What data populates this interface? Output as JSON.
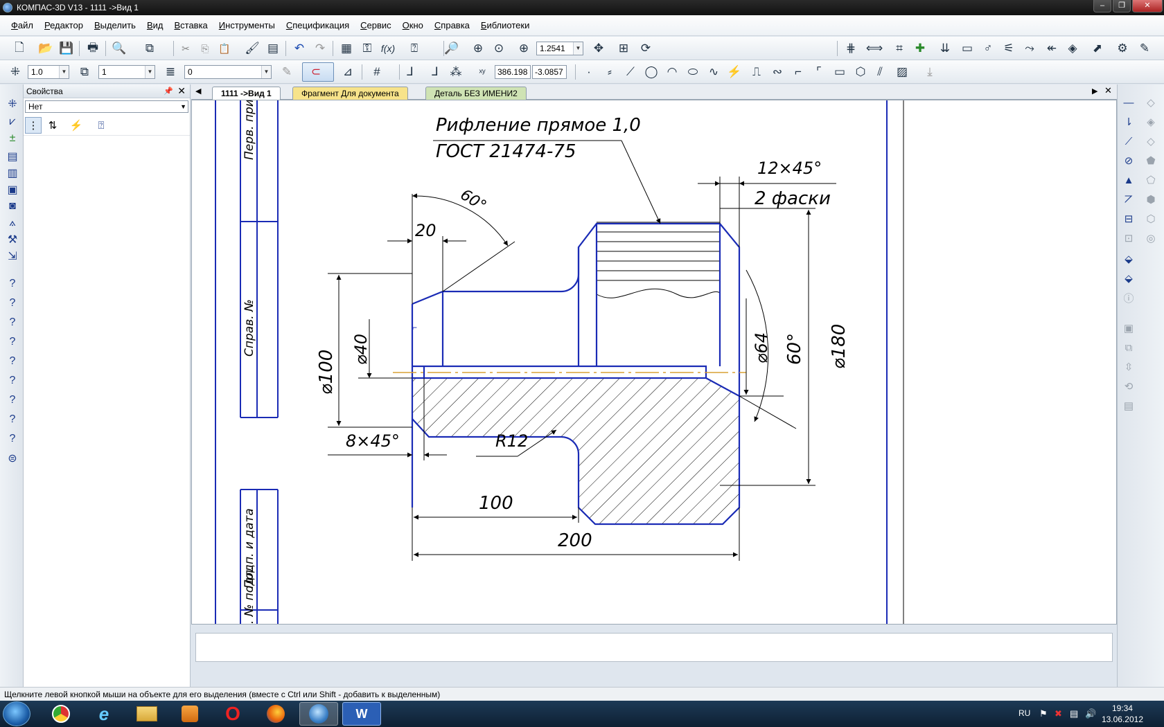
{
  "window": {
    "title": "КОМПАС-3D V13 - 1111 ->Вид 1",
    "controls": [
      "‒",
      "❐",
      "✕"
    ]
  },
  "menu": [
    "Файл",
    "Редактор",
    "Выделить",
    "Вид",
    "Вставка",
    "Инструменты",
    "Спецификация",
    "Сервис",
    "Окно",
    "Справка",
    "Библиотеки"
  ],
  "toolbar1": {
    "zoom_value": "1.2541"
  },
  "toolbar2": {
    "step_value": "1.0",
    "view_value": "1",
    "layer_value": "0",
    "coord_x": "386.198",
    "coord_y": "-3.0857"
  },
  "properties": {
    "title": "Свойства",
    "selected": "Нет"
  },
  "tabs": [
    {
      "label": "1111 ->Вид 1"
    },
    {
      "label": "Фрагмент Для документа"
    },
    {
      "label": "Деталь БЕЗ ИМЕНИ2"
    }
  ],
  "drawing": {
    "frame_labels": [
      "Перв. прим.",
      "Справ. №",
      "Подп. и дата",
      "Инв. № подл."
    ],
    "note_line1": "Рифление прямое 1,0",
    "note_line2": "ГОСТ 21474-75",
    "chamfer_top": "12×45°",
    "chamfer_top_note": "2 фаски",
    "angle_top": "60°",
    "dim_20": "20",
    "dim_d100": "⌀100",
    "dim_d40": "⌀40",
    "dim_d64": "⌀64",
    "angle_right": "60°",
    "dim_d180": "⌀180",
    "chamfer_left": "8×45°",
    "radius": "R12",
    "dim_100": "100",
    "dim_200": "200"
  },
  "status_text": "Щелкните левой кнопкой мыши на объекте для его выделения (вместе с Ctrl или Shift - добавить к выделенным)",
  "taskbar": {
    "apps": [
      "chrome-icon",
      "ie-icon",
      "explorer-icon",
      "media-player-icon",
      "opera-icon",
      "firefox-icon",
      "kompas-icon",
      "word-icon"
    ],
    "word_label": "W",
    "language": "RU",
    "time": "19:34",
    "date": "13.06.2012"
  },
  "colors": {
    "outline": "#1a2bb5",
    "axis": "#d9a033",
    "frame": "#1a2bb5"
  }
}
